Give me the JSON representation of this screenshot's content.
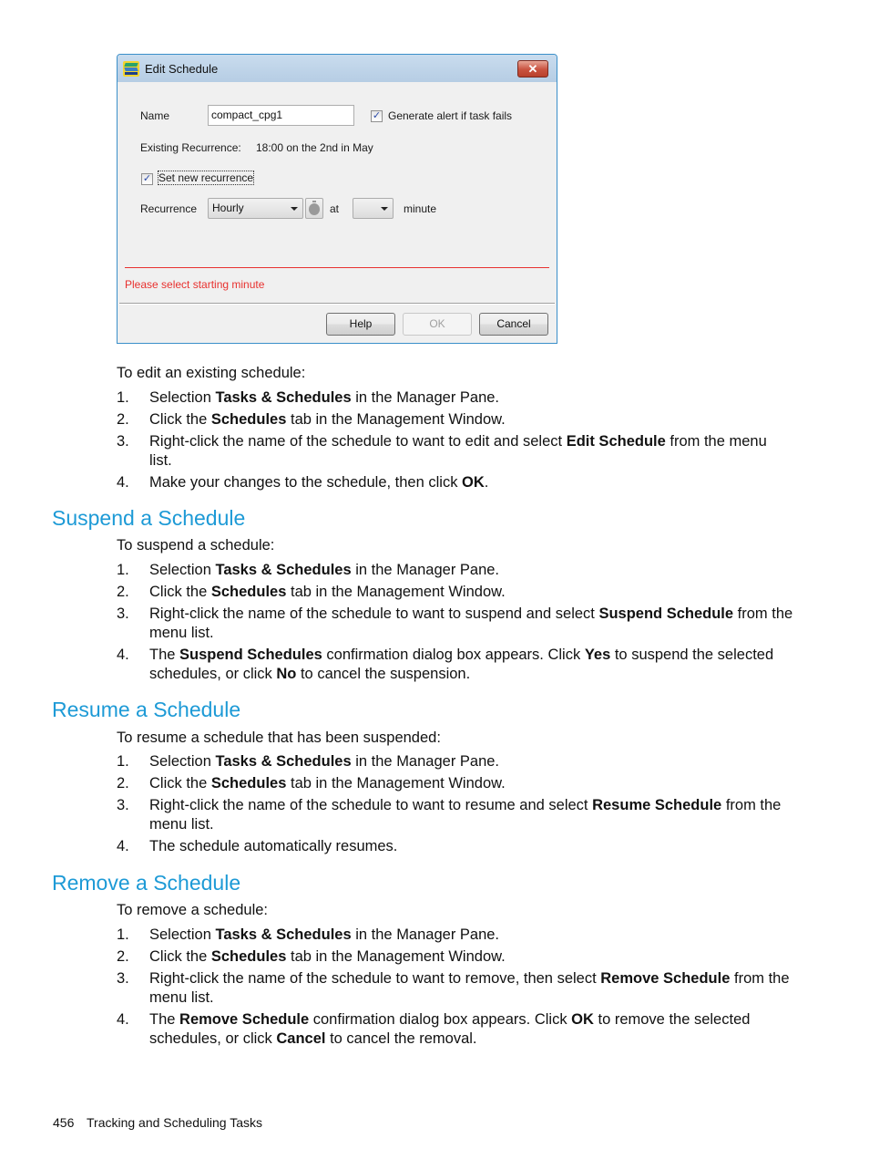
{
  "dialog": {
    "title": "Edit Schedule",
    "close_label": "✕",
    "name_label": "Name",
    "name_value": "compact_cpg1",
    "alert_checkbox_label": "Generate alert if task fails",
    "alert_checked": true,
    "existing_recurrence_label": "Existing Recurrence:",
    "existing_recurrence_value": "18:00 on the 2nd in May",
    "set_new_recurrence_label": "Set new recurrence",
    "set_new_recurrence_checked": true,
    "recurrence_label": "Recurrence",
    "recurrence_value": "Hourly",
    "at_label": "at",
    "minute_value": "",
    "minute_label": "minute",
    "error_message": "Please select starting minute",
    "check_mark": "✓",
    "buttons": {
      "help": "Help",
      "ok": "OK",
      "cancel": "Cancel"
    },
    "colors": {
      "error": "#e8312f",
      "border": "#3a8fc9"
    }
  },
  "edit_section": {
    "intro": "To edit an existing schedule:",
    "steps": [
      {
        "num": "1.",
        "parts": [
          "Selection ",
          "Tasks & Schedules",
          " in the Manager Pane."
        ]
      },
      {
        "num": "2.",
        "parts": [
          "Click the ",
          "Schedules",
          " tab in the Management Window."
        ]
      },
      {
        "num": "3.",
        "parts": [
          "Right-click the name of the schedule to want to edit and select ",
          "Edit Schedule",
          " from the menu list."
        ]
      },
      {
        "num": "4.",
        "parts": [
          "Make your changes to the schedule, then click ",
          "OK",
          "."
        ]
      }
    ]
  },
  "suspend_section": {
    "heading": "Suspend a Schedule",
    "intro": "To suspend a schedule:",
    "steps": [
      {
        "num": "1.",
        "parts": [
          "Selection ",
          "Tasks & Schedules",
          " in the Manager Pane."
        ]
      },
      {
        "num": "2.",
        "parts": [
          "Click the ",
          "Schedules",
          " tab in the Management Window."
        ]
      },
      {
        "num": "3.",
        "parts": [
          "Right-click the name of the schedule to want to suspend and select ",
          "Suspend Schedule",
          " from the menu list."
        ]
      },
      {
        "num": "4.",
        "parts": [
          "The ",
          "Suspend Schedules",
          " confirmation dialog box appears. Click ",
          "Yes",
          " to suspend the selected schedules, or click ",
          "No",
          " to cancel the suspension."
        ]
      }
    ]
  },
  "resume_section": {
    "heading": "Resume a Schedule",
    "intro": "To resume a schedule that has been suspended:",
    "steps": [
      {
        "num": "1.",
        "parts": [
          "Selection ",
          "Tasks & Schedules",
          " in the Manager Pane."
        ]
      },
      {
        "num": "2.",
        "parts": [
          "Click the ",
          "Schedules",
          " tab in the Management Window."
        ]
      },
      {
        "num": "3.",
        "parts": [
          "Right-click the name of the schedule to want to resume and select ",
          "Resume Schedule",
          " from the menu list."
        ]
      },
      {
        "num": "4.",
        "parts": [
          "The schedule automatically resumes."
        ]
      }
    ]
  },
  "remove_section": {
    "heading": "Remove a Schedule",
    "intro": "To remove a schedule:",
    "steps": [
      {
        "num": "1.",
        "parts": [
          "Selection ",
          "Tasks & Schedules",
          " in the Manager Pane."
        ]
      },
      {
        "num": "2.",
        "parts": [
          "Click the ",
          "Schedules",
          " tab in the Management Window."
        ]
      },
      {
        "num": "3.",
        "parts": [
          "Right-click the name of the schedule to want to remove, then select ",
          "Remove Schedule",
          " from the menu list."
        ]
      },
      {
        "num": "4.",
        "parts": [
          "The ",
          "Remove Schedule",
          " confirmation dialog box appears. Click ",
          "OK",
          " to remove the selected schedules, or click ",
          "Cancel",
          " to cancel the removal."
        ]
      }
    ]
  },
  "footer": {
    "page_number": "456",
    "chapter": "Tracking and Scheduling Tasks"
  },
  "colors": {
    "heading": "#1d9ad6",
    "text": "#111111"
  }
}
